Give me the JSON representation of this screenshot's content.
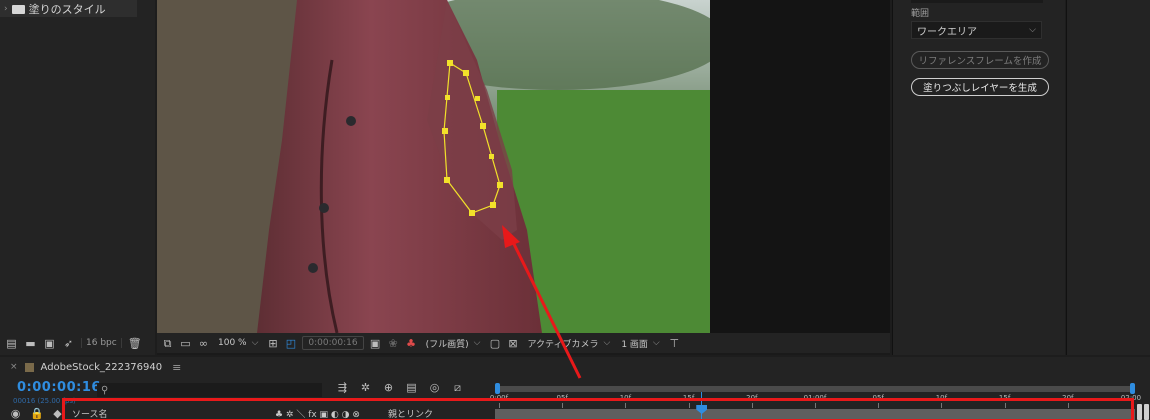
{
  "project_panel": {
    "folder_label": "塗りのスタイル",
    "bit_depth": "16 bpc",
    "icons": [
      "interpret-footage-icon",
      "new-folder-icon",
      "new-composition-icon",
      "flowchart-icon",
      "trash-icon"
    ]
  },
  "viewer_toolbar": {
    "zoom": "100 %",
    "timecode": "0:00:00:16",
    "resolution": "(フル画質)",
    "camera": "アクティブカメラ",
    "views": "1 画面"
  },
  "properties_panel": {
    "range_label": "範囲",
    "range_value": "ワークエリア",
    "reference_frame_button": "リファレンスフレームを作成",
    "generate_fill_layer_button": "塗りつぶしレイヤーを生成"
  },
  "timeline": {
    "comp_tab": "AdobeStock_222376940",
    "current_time": "0:00:00:16",
    "frame_info": "00016 (25.00 fps)",
    "search_placeholder": "",
    "column_source_name": "ソース名",
    "column_parent": "親とリンク",
    "switches_glyphs": "♣ ✲ ＼ fx ▣ ◐ ◑ ⊗",
    "ruler_labels": [
      {
        "label": "0:00f",
        "frame": 0
      },
      {
        "label": "05f",
        "frame": 5
      },
      {
        "label": "10f",
        "frame": 10
      },
      {
        "label": "15f",
        "frame": 15
      },
      {
        "label": "20f",
        "frame": 20
      },
      {
        "label": "01:00f",
        "frame": 25
      },
      {
        "label": "05f",
        "frame": 30
      },
      {
        "label": "10f",
        "frame": 35
      },
      {
        "label": "15f",
        "frame": 40
      },
      {
        "label": "20f",
        "frame": 45
      },
      {
        "label": "02:00",
        "frame": 50
      }
    ],
    "playhead_frame": 16,
    "total_frames": 50
  },
  "colors": {
    "accent_blue": "#2f8de0",
    "annotation_red": "#e8191a",
    "mask_yellow": "#f2e12a"
  }
}
